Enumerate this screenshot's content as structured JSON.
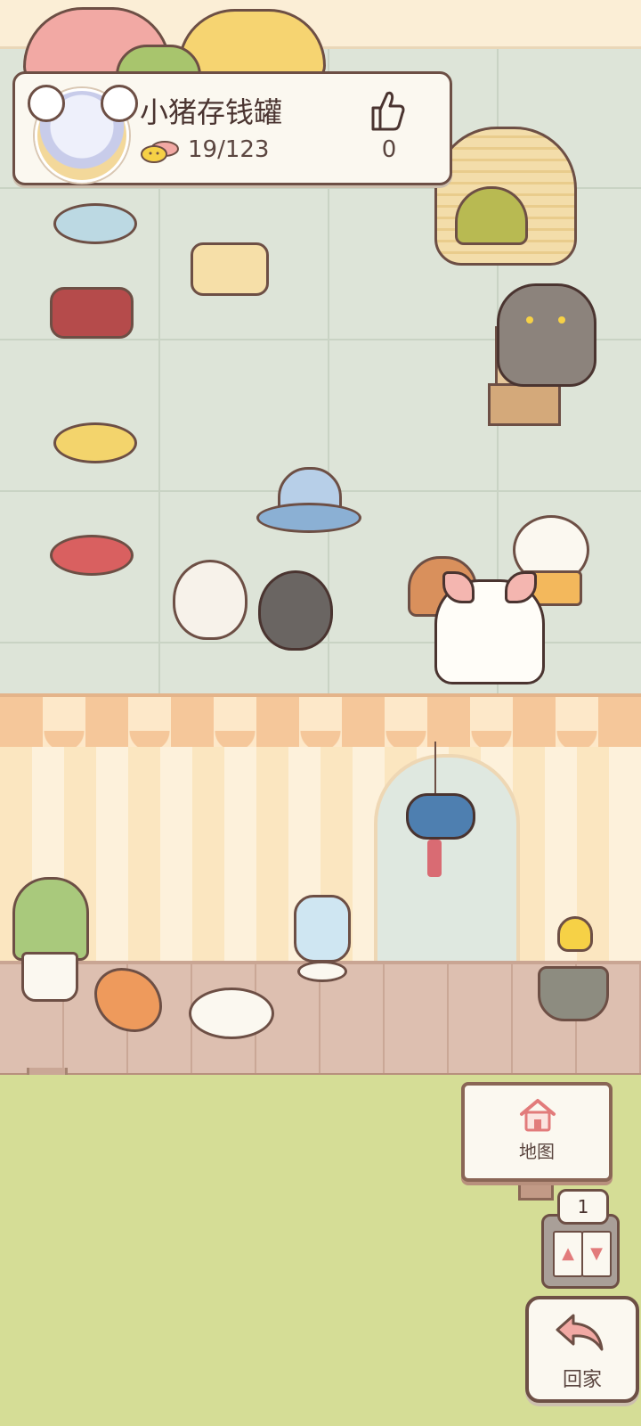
{
  "profile": {
    "room_name": "小猪存钱罐",
    "fish_count": "19/123",
    "likes": "0"
  },
  "icons": {
    "fish": "fish-coin-icon",
    "like": "thumbs-up-icon",
    "map": "house-icon",
    "home": "return-arrow-icon",
    "floor_up": "triangle-up-icon",
    "floor_down": "triangle-down-icon"
  },
  "map_sign": {
    "label": "地图"
  },
  "floor": {
    "current": "1",
    "up_glyph": "▲",
    "down_glyph": "▼"
  },
  "home_button": {
    "label": "回家"
  },
  "colors": {
    "outline": "#6d4f45",
    "card": "#fbf8f0",
    "lawn": "#d5dd96",
    "awning": "#f5c79a",
    "accent_pink": "#e27b7b"
  }
}
